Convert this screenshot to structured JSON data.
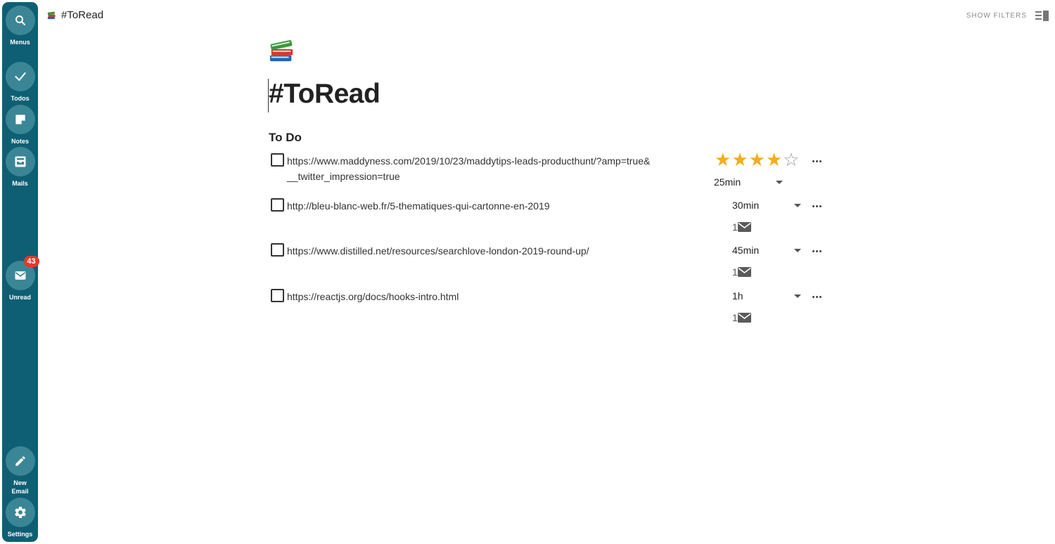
{
  "sidebar": {
    "items": [
      {
        "label": "Menus",
        "icon": "search-icon"
      },
      {
        "label": "Todos",
        "icon": "check-icon"
      },
      {
        "label": "Notes",
        "icon": "note-icon"
      },
      {
        "label": "Mails",
        "icon": "inbox-icon"
      },
      {
        "label": "Unread",
        "icon": "envelope-icon",
        "badge": "43"
      },
      {
        "label": "New Email",
        "icon": "pencil-icon"
      },
      {
        "label": "Settings",
        "icon": "gear-icon"
      }
    ]
  },
  "header": {
    "title": "#ToRead",
    "emoji_icon": "books-icon",
    "show_filters": "SHOW FILTERS"
  },
  "main": {
    "title": "#ToRead",
    "section_title": "To Do",
    "items": [
      {
        "url": "https://www.maddyness.com/2019/10/23/maddytips-leads-producthunt/?amp=true&__twitter_impression=true",
        "rating": 4,
        "rating_max": 5,
        "duration": "25min",
        "mail_count": null
      },
      {
        "url": "http://bleu-blanc-web.fr/5-thematiques-qui-cartonne-en-2019",
        "rating": null,
        "duration": "30min",
        "mail_count": "1"
      },
      {
        "url": "https://www.distilled.net/resources/searchlove-london-2019-round-up/",
        "rating": null,
        "duration": "45min",
        "mail_count": "1"
      },
      {
        "url": "https://reactjs.org/docs/hooks-intro.html",
        "rating": null,
        "duration": "1h",
        "mail_count": "1"
      }
    ]
  },
  "colors": {
    "sidebar_bg": "#0e5f73",
    "sidebar_button": "#3a8696",
    "badge": "#e03a2e",
    "star": "#f5ad1b"
  }
}
